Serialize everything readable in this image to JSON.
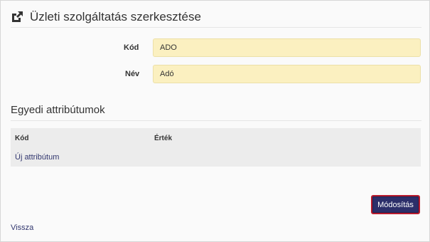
{
  "header": {
    "title": "Üzleti szolgáltatás szerkesztése",
    "icon": "external-link-icon"
  },
  "form": {
    "code_label": "Kód",
    "code_value": "ADO",
    "name_label": "Név",
    "name_value": "Adó"
  },
  "attributes": {
    "title": "Egyedi attribútumok",
    "columns": [
      "Kód",
      "Érték"
    ],
    "add_label": "Új attribútum"
  },
  "actions": {
    "save_label": "Módosítás",
    "back_label": "Vissza"
  },
  "colors": {
    "input_bg": "#fbf0c0",
    "button_bg": "#2c2f6a",
    "button_border": "#b81b2e",
    "link": "#31366e"
  }
}
